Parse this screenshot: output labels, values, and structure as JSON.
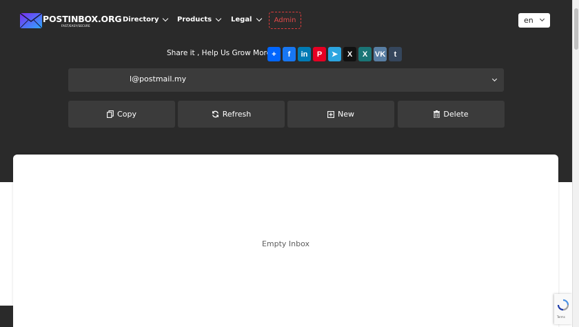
{
  "brand": {
    "name": "POSTINBOX.ORG",
    "tagline": "FAST/EASY/SECURE"
  },
  "nav": {
    "directory": "Directory",
    "products": "Products",
    "legal": "Legal",
    "admin": "Admin"
  },
  "language": {
    "selected": "en"
  },
  "share": {
    "text": "Share it , Help Us Grow More ♥",
    "icons": [
      {
        "name": "share-add",
        "glyph": "+",
        "color": "#0166ff"
      },
      {
        "name": "facebook",
        "glyph": "f",
        "color": "#1877f2"
      },
      {
        "name": "linkedin",
        "glyph": "in",
        "color": "#007bb5"
      },
      {
        "name": "pinterest",
        "glyph": "P",
        "color": "#e60023"
      },
      {
        "name": "telegram",
        "glyph": "➤",
        "color": "#2ca5e0"
      },
      {
        "name": "x-twitter",
        "glyph": "X",
        "color": "#111111"
      },
      {
        "name": "xing",
        "glyph": "X",
        "color": "#1a7576"
      },
      {
        "name": "vk",
        "glyph": "VK",
        "color": "#587ea3"
      },
      {
        "name": "tumblr",
        "glyph": "t",
        "color": "#35465c"
      }
    ]
  },
  "email": {
    "address": "l@postmail.my"
  },
  "actions": {
    "copy": "Copy",
    "refresh": "Refresh",
    "new": "New",
    "delete": "Delete"
  },
  "inbox": {
    "empty_text": "Empty Inbox"
  },
  "recaptcha": {
    "terms": "Terms"
  },
  "colors": {
    "header_bg": "#2a2a2a",
    "panel_bg": "#3b3b3b",
    "admin_accent": "#e03c3c"
  }
}
